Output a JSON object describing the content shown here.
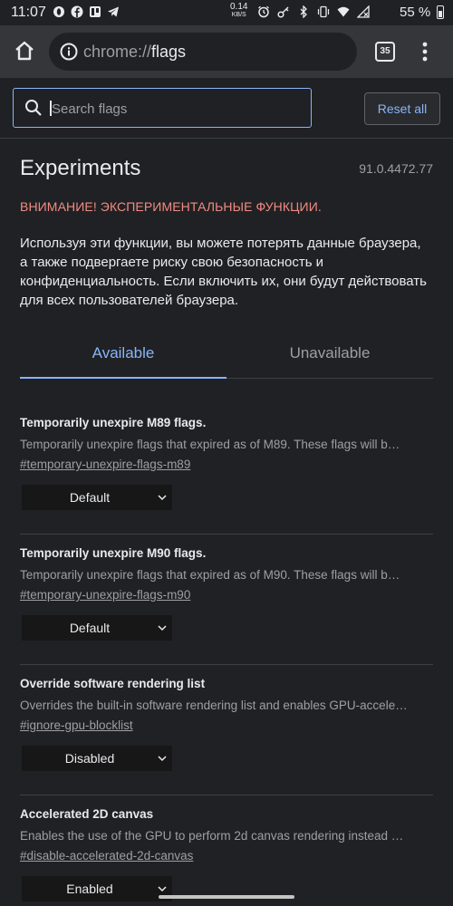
{
  "status_bar": {
    "time": "11:07",
    "net_speed": "0.14",
    "net_unit": "KB/S",
    "battery": "55 %"
  },
  "toolbar": {
    "url_scheme": "chrome://",
    "url_host": "flags",
    "tab_count": "35"
  },
  "search": {
    "placeholder": "Search flags",
    "value": "",
    "reset_label": "Reset all"
  },
  "header": {
    "title": "Experiments",
    "version": "91.0.4472.77",
    "warning": "ВНИМАНИЕ! ЭКСПЕРИМЕНТАЛЬНЫЕ ФУНКЦИИ.",
    "description": "Используя эти функции, вы можете потерять данные браузера, а также подвергаете риску свою безопасность и конфиденциальность. Если включить их, они будут действовать для всех пользователей браузера."
  },
  "tabs": [
    {
      "label": "Available",
      "active": true
    },
    {
      "label": "Unavailable",
      "active": false
    }
  ],
  "flags": [
    {
      "name": "Temporarily unexpire M89 flags.",
      "description": "Temporarily unexpire flags that expired as of M89. These flags will b…",
      "link": "#temporary-unexpire-flags-m89",
      "value": "Default"
    },
    {
      "name": "Temporarily unexpire M90 flags.",
      "description": "Temporarily unexpire flags that expired as of M90. These flags will b…",
      "link": "#temporary-unexpire-flags-m90",
      "value": "Default"
    },
    {
      "name": "Override software rendering list",
      "description": "Overrides the built-in software rendering list and enables GPU-accele…",
      "link": "#ignore-gpu-blocklist",
      "value": "Disabled"
    },
    {
      "name": "Accelerated 2D canvas",
      "description": "Enables the use of the GPU to perform 2d canvas rendering instead …",
      "link": "#disable-accelerated-2d-canvas",
      "value": "Enabled"
    }
  ],
  "colors": {
    "background": "#202124",
    "toolbar": "#35363a",
    "accent": "#8ab4f8",
    "warning": "#f28b82"
  }
}
